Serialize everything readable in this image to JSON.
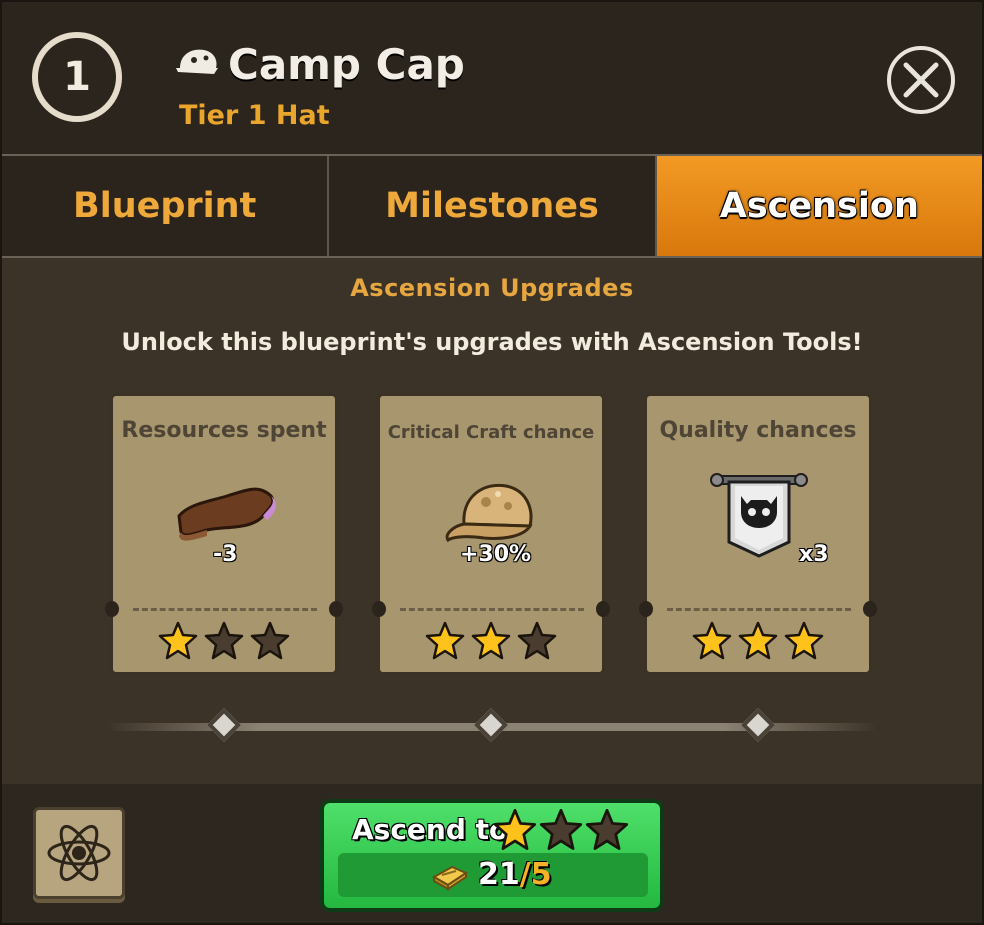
{
  "header": {
    "tier_number": "1",
    "title": "Camp Cap",
    "subtitle": "Tier 1 Hat"
  },
  "tabs": [
    {
      "label": "Blueprint",
      "active": false
    },
    {
      "label": "Milestones",
      "active": false
    },
    {
      "label": "Ascension",
      "active": true
    }
  ],
  "section": {
    "title": "Ascension Upgrades",
    "description": "Unlock this blueprint's upgrades with Ascension Tools!"
  },
  "cards": [
    {
      "label": "Resources spent",
      "value": "-3",
      "icon": "leather-icon",
      "stars_filled": 1,
      "stars_total": 3
    },
    {
      "label": "Critical Craft chance",
      "value": "+30%",
      "icon": "cap-icon",
      "stars_filled": 2,
      "stars_total": 3
    },
    {
      "label": "Quality chances",
      "value": "x3",
      "icon": "skull-banner-icon",
      "stars_filled": 3,
      "stars_total": 3
    }
  ],
  "ascend": {
    "label": "Ascend to",
    "stars_filled": 1,
    "stars_total": 3,
    "have": "21",
    "need": "5",
    "separator": "/"
  },
  "colors": {
    "accent_orange": "#e88a16",
    "tab_text": "#eea93a",
    "button_green": "#2fc44b",
    "star_gold": "#ffc21a",
    "star_empty": "#4a3d2f"
  }
}
